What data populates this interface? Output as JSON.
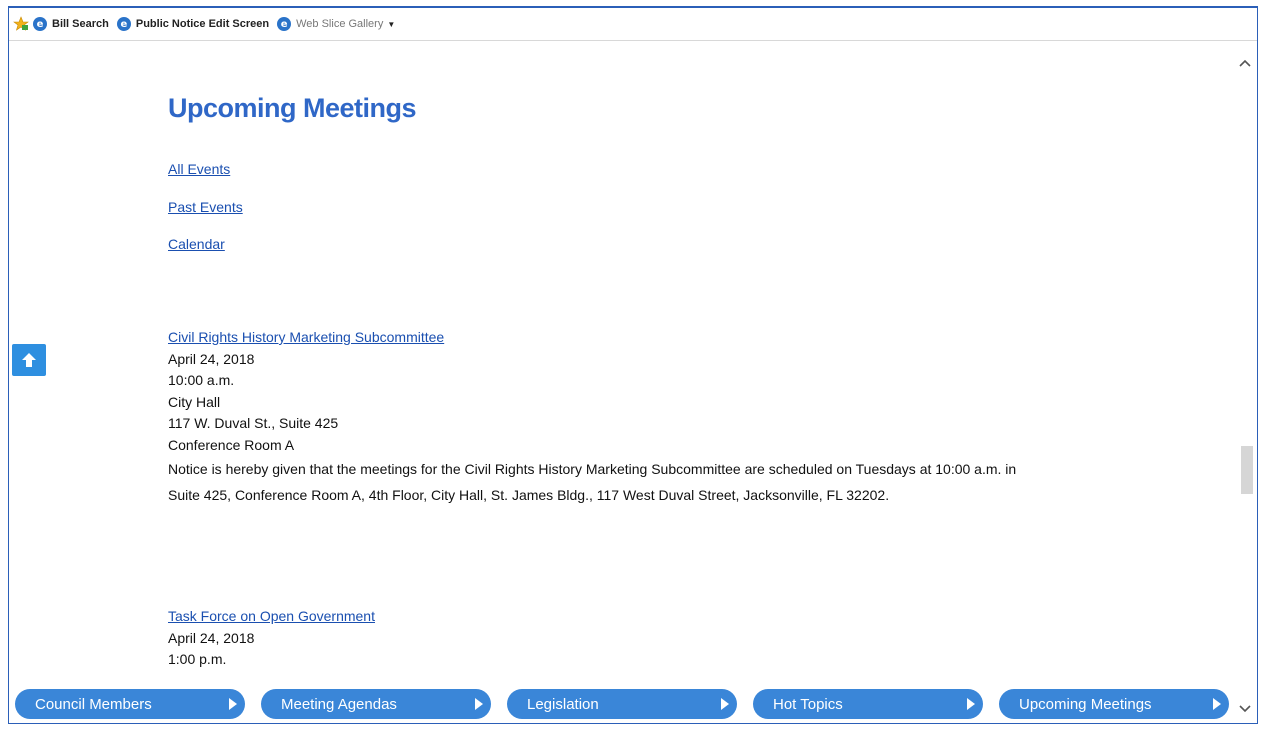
{
  "favorites": {
    "items": [
      {
        "label": "Bill Search"
      },
      {
        "label": "Public Notice Edit Screen"
      },
      {
        "label": "Web Slice Gallery"
      }
    ]
  },
  "main": {
    "title": "Upcoming Meetings",
    "links": [
      "All Events",
      "Past Events",
      "Calendar"
    ],
    "events": [
      {
        "title": "Civil Rights History Marketing Subcommittee",
        "date": "April 24, 2018",
        "time": "10:00 a.m.",
        "venue": "City Hall",
        "address": "117 W. Duval St., Suite 425",
        "room": "Conference Room A",
        "notice": "Notice is hereby given that the meetings for the Civil Rights History Marketing Subcommittee are scheduled on Tuesdays at 10:00 a.m. in Suite 425, Conference Room A, 4th Floor, City Hall, St. James Bldg., 117 West Duval Street, Jacksonville, FL 32202."
      },
      {
        "title": "Task Force on Open Government",
        "date": "April 24, 2018",
        "time": "1:00 p.m."
      }
    ]
  },
  "bottom_nav": {
    "items": [
      {
        "label": "Council Members"
      },
      {
        "label": "Meeting Agendas"
      },
      {
        "label": "Legislation"
      },
      {
        "label": "Hot Topics"
      },
      {
        "label": "Upcoming Meetings"
      }
    ]
  },
  "colors": {
    "title": "#2f67c7",
    "link": "#1a4fb0",
    "nav_pill": "#3a86d8",
    "to_top": "#2e8fe0"
  },
  "icons": [
    "favorites-star-icon",
    "ie-icon",
    "dropdown-caret-icon",
    "arrow-up-icon",
    "chevron-right-icon",
    "scroll-up-icon",
    "scroll-down-icon"
  ]
}
